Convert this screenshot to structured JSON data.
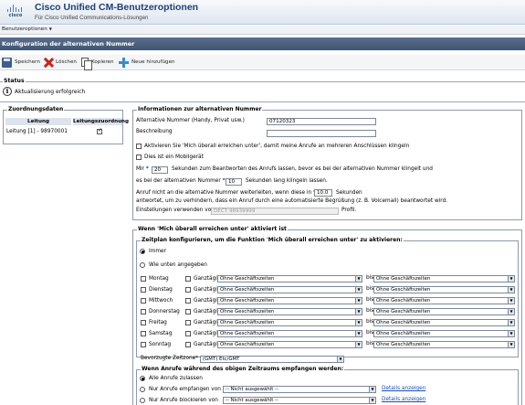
{
  "header": {
    "logo_text": "cisco",
    "title": "Cisco Unified CM-Benutzeroptionen",
    "subtitle": "Für Cisco Unified Communications-Lösungen"
  },
  "menu": {
    "options_label": "Benutzeroptionen"
  },
  "page": {
    "title": "Konfiguration der alternativen Nummer"
  },
  "toolbar": {
    "save": "Speichern",
    "delete": "Löschen",
    "copy": "Kopieren",
    "add_new": "Neue hinzufügen"
  },
  "status": {
    "legend": "Status",
    "message": "Aktualisierung erfolgreich"
  },
  "assoc": {
    "legend": "Zuordnungsdaten",
    "col_line": "Leitung",
    "col_assoc": "Leitungszuordnung",
    "row_line": "Leitung [1] - 98970001",
    "row_checked": true
  },
  "info": {
    "legend": "Informationen zur alternativen Nummer",
    "alt_number_label": "Alternative Nummer (Handy, Privat usw.)",
    "alt_number_value": "07120323",
    "description_label": "Beschreibung",
    "description_value": "",
    "enable_mobile_connect_label": "Aktivieren Sie 'Mich überall erreichen unter', damit meine Anrufe an mehreren Anschlüssen klingeln",
    "is_mobile_label": "Dies ist ein Mobilgerät",
    "min_label": "Mir *",
    "min_value": "20",
    "min_text": "Sekunden zum Beantworten des Anrufs lassen, bevor es bei der alternativen Nummer klingelt und",
    "ring_pre": "es bei der alternativen Nummer *",
    "ring_value": "10",
    "ring_text": "Sekunden lang klingeln lassen.",
    "forward_pre": "Anruf nicht an die alternative Nummer weiterleiten, wenn diese in *",
    "forward_value": "10.0",
    "forward_unit": "Sekunden",
    "forward_text2": "antwortet, um zu verhindern, dass ein Anruf durch eine automatisierte Begrüßung (z. B. Voicemail) beantwortet wird.",
    "profile_pre": "Einstellungen verwenden vom *",
    "profile_value": "DECT 98939999",
    "profile_post": "Profil."
  },
  "reach": {
    "legend": "Wenn 'Mich überall erreichen unter' aktiviert ist",
    "schedule": {
      "legend": "Zeitplan konfigurieren, um die Funktion 'Mich überall erreichen unter' zu aktivieren:",
      "always": "Immer",
      "as_below": "Wie unten angegeben",
      "all_day": "Ganztägig",
      "no_office_hours": "Ohne Geschäftszeiten",
      "to": "bis",
      "days": [
        "Montag",
        "Dienstag",
        "Mittwoch",
        "Donnerstag",
        "Freitag",
        "Samstag",
        "Sonntag"
      ],
      "timezone_label": "Bevorzugte Zeitzone*",
      "timezone_value": "(GMT) Etc/GMT"
    },
    "receive": {
      "legend": "Wenn Anrufe während des obigen Zeitraums empfangen werden:",
      "allow_all": "Alle Anrufe zulassen",
      "only_from": "Nur Anrufe empfangen von",
      "block_from": "Nur Anrufe blockieren von",
      "not_selected": "-- Nicht ausgewählt --",
      "details": "Details anzeigen"
    }
  }
}
